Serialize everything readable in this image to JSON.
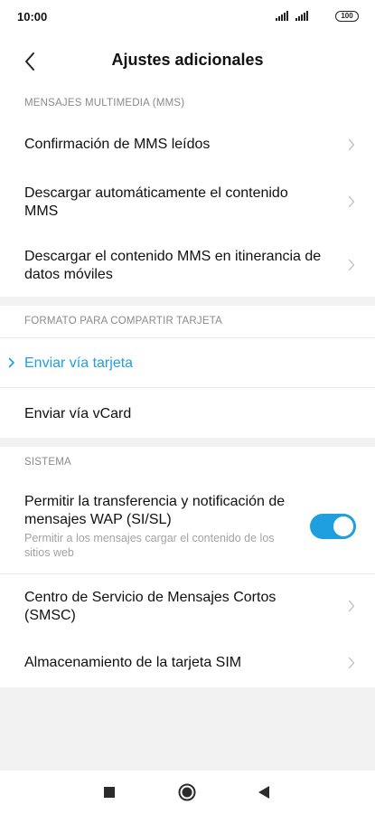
{
  "status_bar": {
    "time": "10:00",
    "battery": "100"
  },
  "header": {
    "title": "Ajustes adicionales"
  },
  "sections": {
    "mms": {
      "label": "MENSAJES MULTIMEDIA (MMS)",
      "items": [
        {
          "title": "Confirmación de MMS leídos"
        },
        {
          "title": "Descargar automáticamente el contenido MMS"
        },
        {
          "title": "Descargar el contenido MMS en itinerancia de datos móviles"
        }
      ]
    },
    "card": {
      "label": "FORMATO PARA COMPARTIR TARJETA",
      "items": [
        {
          "title": "Enviar vía tarjeta",
          "selected": true
        },
        {
          "title": "Enviar vía vCard",
          "selected": false
        }
      ]
    },
    "system": {
      "label": "SISTEMA",
      "items": [
        {
          "title": "Permitir la transferencia y notificación de mensajes WAP (SI/SL)",
          "subtitle": "Permitir a los mensajes cargar el contenido de los sitios web",
          "toggle_on": true
        },
        {
          "title": "Centro de Servicio de Mensajes Cortos (SMSC)"
        },
        {
          "title": "Almacenamiento de la tarjeta SIM"
        }
      ]
    }
  },
  "colors": {
    "accent": "#1f9fe0",
    "section_label": "#8a8a8a",
    "background": "#f2f2f2"
  },
  "icons": {
    "back": "chevron-left-icon",
    "row": "chevron-right-icon",
    "selected": "chevron-right-icon",
    "nav": [
      "square-icon",
      "circle-icon",
      "triangle-left-icon"
    ]
  }
}
